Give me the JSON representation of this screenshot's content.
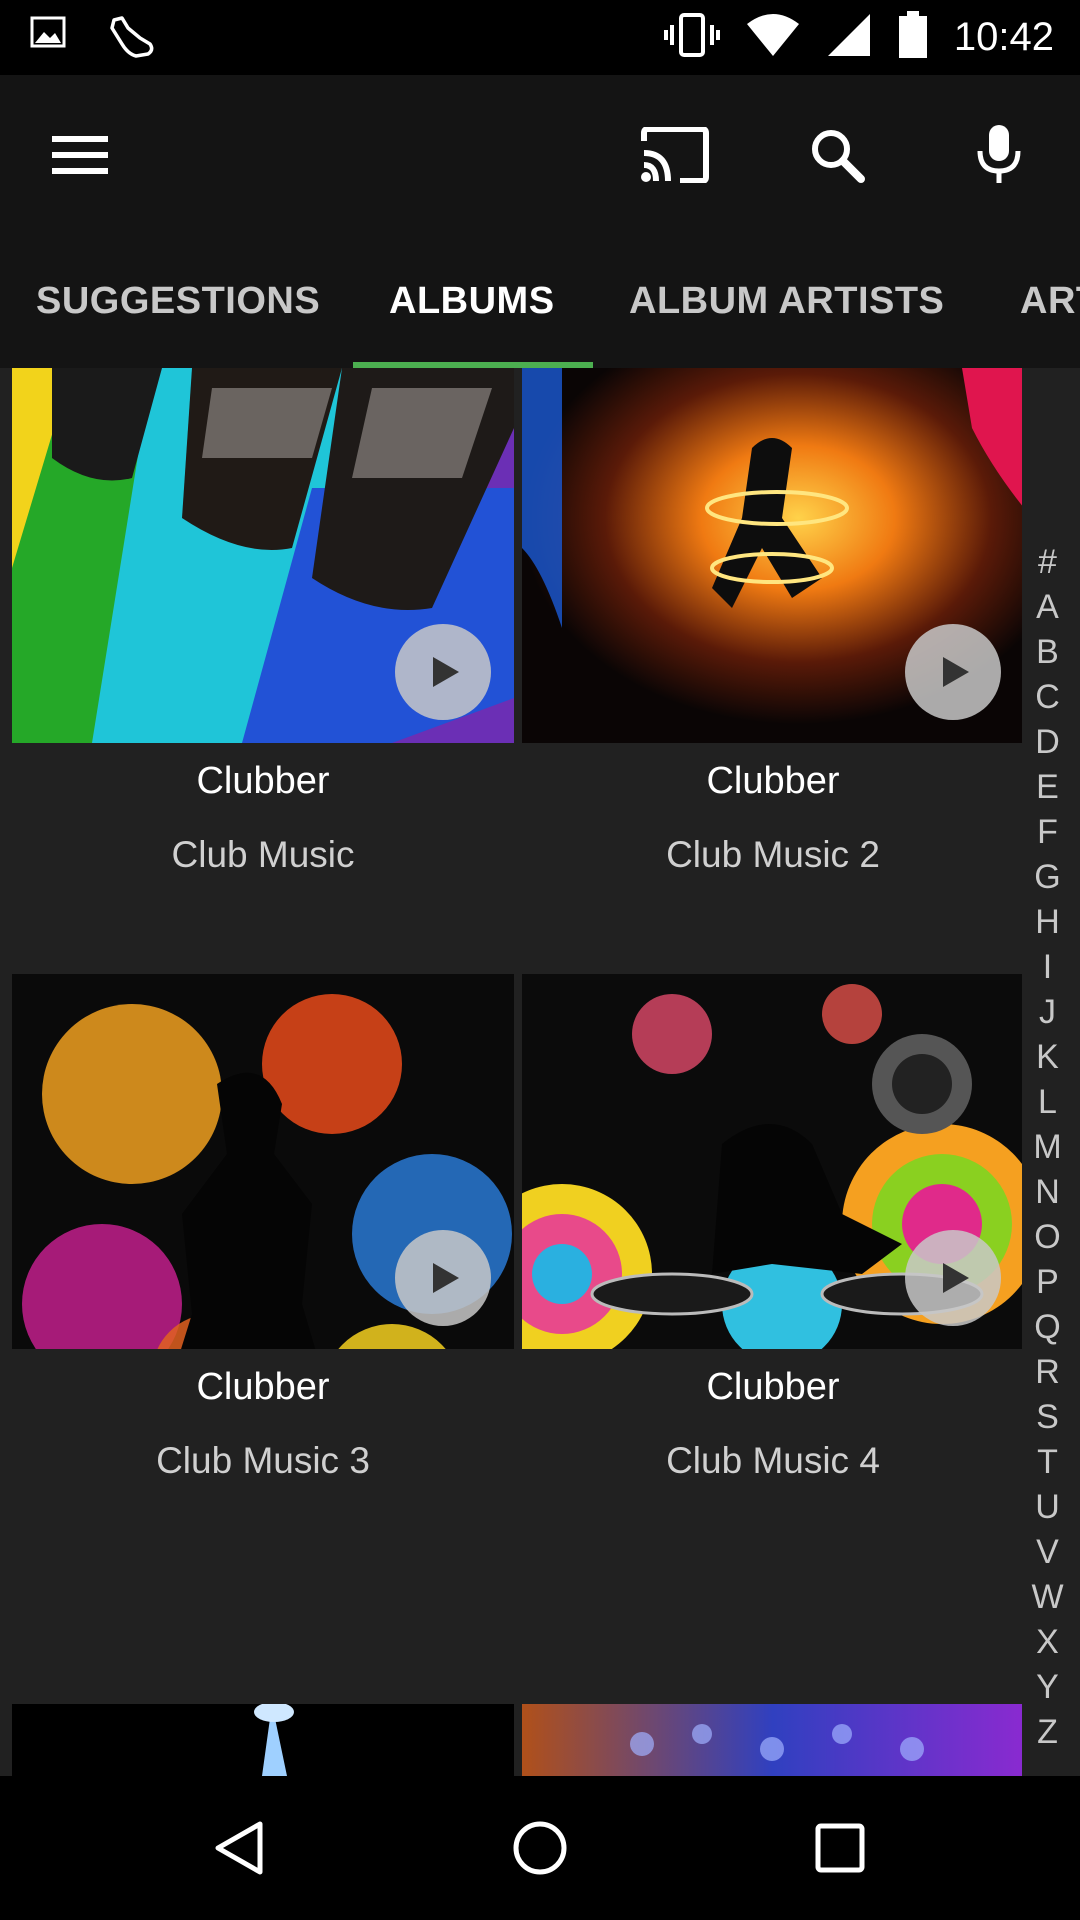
{
  "status_bar": {
    "left_icons": [
      "image-notification-icon",
      "sneaker-notification-icon"
    ],
    "right_icons": [
      "vibrate-icon",
      "wifi-icon",
      "cell-signal-icon",
      "battery-icon"
    ],
    "time": "10:42"
  },
  "toolbar": {
    "icons": [
      "menu-icon",
      "cast-icon",
      "search-icon",
      "mic-icon"
    ]
  },
  "tabs": [
    {
      "label": "SUGGESTIONS",
      "active": false
    },
    {
      "label": "ALBUMS",
      "active": true
    },
    {
      "label": "ALBUM ARTISTS",
      "active": false
    },
    {
      "label": "ARTISTS",
      "active": false
    }
  ],
  "albums": [
    {
      "artist": "Clubber",
      "title": "Club Music"
    },
    {
      "artist": "Clubber",
      "title": "Club Music 2"
    },
    {
      "artist": "Clubber",
      "title": "Club Music 3"
    },
    {
      "artist": "Clubber",
      "title": "Club Music 4"
    }
  ],
  "alphabet_index": [
    "#",
    "A",
    "B",
    "C",
    "D",
    "E",
    "F",
    "G",
    "H",
    "I",
    "J",
    "K",
    "L",
    "M",
    "N",
    "O",
    "P",
    "Q",
    "R",
    "S",
    "T",
    "U",
    "V",
    "W",
    "X",
    "Y",
    "Z"
  ],
  "colors": {
    "accent": "#4caf50",
    "background": "#212121",
    "toolbar": "#141414"
  },
  "nav_bar": {
    "icons": [
      "back-icon",
      "home-icon",
      "recents-icon"
    ]
  }
}
